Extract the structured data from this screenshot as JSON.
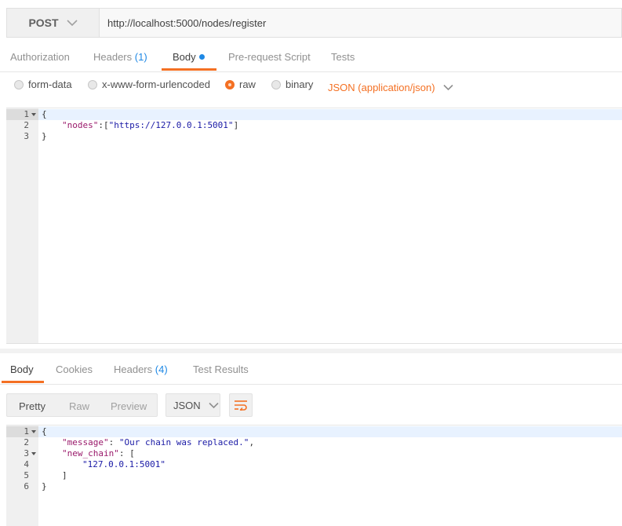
{
  "request": {
    "method": "POST",
    "url": "http://localhost:5000/nodes/register"
  },
  "request_tabs": [
    {
      "label": "Authorization"
    },
    {
      "label": "Headers",
      "count": "(1)"
    },
    {
      "label": "Body"
    },
    {
      "label": "Pre-request Script"
    },
    {
      "label": "Tests"
    }
  ],
  "body_types": [
    {
      "label": "form-data",
      "selected": false
    },
    {
      "label": "x-www-form-urlencoded",
      "selected": false
    },
    {
      "label": "raw",
      "selected": true
    },
    {
      "label": "binary",
      "selected": false
    }
  ],
  "content_type": "JSON (application/json)",
  "request_body": {
    "line_numbers": [
      "1",
      "2",
      "3"
    ],
    "l1": "{",
    "l2_key": "\"nodes\"",
    "l2_mid": ":[",
    "l2_val": "\"https://127.0.0.1:5001\"",
    "l2_end": "]",
    "l3": "}"
  },
  "response_tabs": [
    {
      "label": "Body"
    },
    {
      "label": "Cookies"
    },
    {
      "label": "Headers",
      "count": "(4)"
    },
    {
      "label": "Test Results"
    }
  ],
  "view_modes": [
    "Pretty",
    "Raw",
    "Preview"
  ],
  "response_format": "JSON",
  "response_body": {
    "line_numbers": [
      "1",
      "2",
      "3",
      "4",
      "5",
      "6"
    ],
    "l1": "{",
    "l2_key": "\"message\"",
    "l2_sep": ": ",
    "l2_val": "\"Our chain was replaced.\"",
    "l2_end": ",",
    "l3_key": "\"new_chain\"",
    "l3_sep": ": [",
    "l4_val": "\"127.0.0.1:5001\"",
    "l5": "]",
    "l6": "}"
  },
  "colors": {
    "accent": "#f47023",
    "badge_blue": "#1e88e5"
  }
}
